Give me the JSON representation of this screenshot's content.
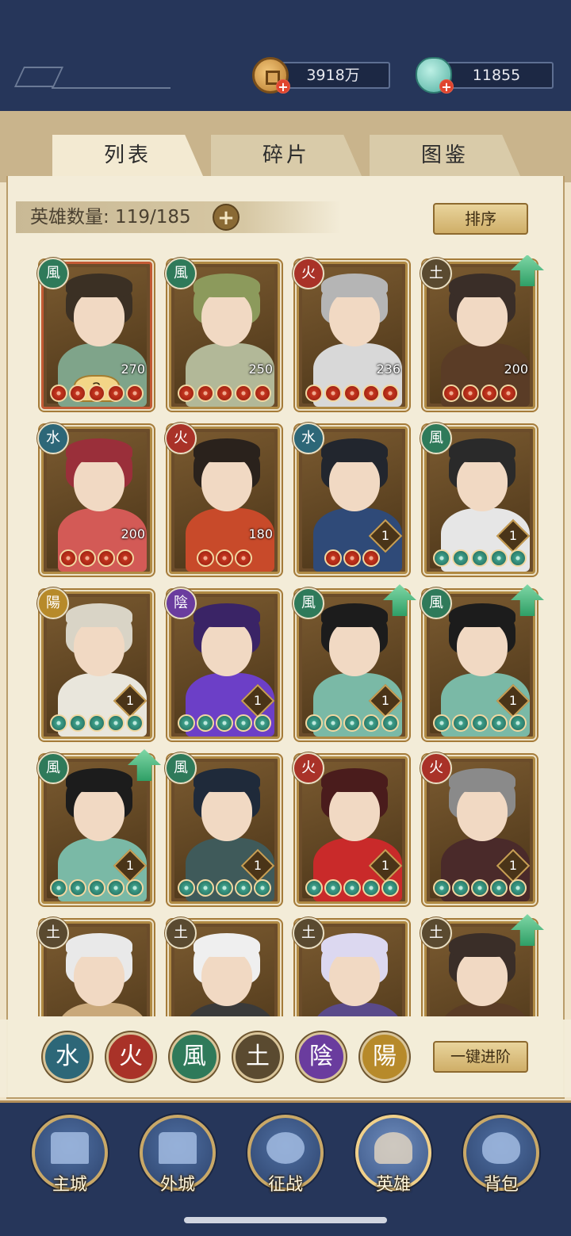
{
  "header": {
    "coins": "3918万",
    "jade": "11855"
  },
  "tabs": [
    {
      "label": "列表",
      "active": true
    },
    {
      "label": "碎片",
      "active": false
    },
    {
      "label": "图鉴",
      "active": false
    }
  ],
  "hero_count": "英雄数量: 119/185",
  "sort_label": "排序",
  "heroes": [
    {
      "element": "風",
      "level": "270",
      "stars": 5,
      "star_color": "red",
      "badge": "2",
      "upgrade": false
    },
    {
      "element": "風",
      "level": "250",
      "stars": 5,
      "star_color": "red",
      "upgrade": false
    },
    {
      "element": "火",
      "level": "236",
      "stars": 5,
      "star_color": "red",
      "upgrade": false
    },
    {
      "element": "土",
      "level": "200",
      "stars": 4,
      "star_color": "red",
      "upgrade": true
    },
    {
      "element": "水",
      "level": "200",
      "stars": 4,
      "star_color": "red",
      "upgrade": false
    },
    {
      "element": "火",
      "level": "180",
      "stars": 3,
      "star_color": "red",
      "upgrade": false
    },
    {
      "element": "水",
      "rank": "1",
      "stars": 3,
      "star_color": "red",
      "upgrade": false
    },
    {
      "element": "風",
      "rank": "1",
      "stars": 5,
      "star_color": "green",
      "upgrade": false
    },
    {
      "element": "陽",
      "rank": "1",
      "stars": 5,
      "star_color": "green",
      "upgrade": false
    },
    {
      "element": "陰",
      "rank": "1",
      "stars": 5,
      "star_color": "green",
      "upgrade": false
    },
    {
      "element": "風",
      "rank": "1",
      "stars": 5,
      "star_color": "green",
      "upgrade": true
    },
    {
      "element": "風",
      "rank": "1",
      "stars": 5,
      "star_color": "green",
      "upgrade": true
    },
    {
      "element": "風",
      "rank": "1",
      "stars": 5,
      "star_color": "green",
      "upgrade": true
    },
    {
      "element": "風",
      "rank": "1",
      "stars": 5,
      "star_color": "green",
      "upgrade": false
    },
    {
      "element": "火",
      "rank": "1",
      "stars": 5,
      "star_color": "green",
      "upgrade": false
    },
    {
      "element": "火",
      "rank": "1",
      "stars": 5,
      "star_color": "green",
      "upgrade": false
    },
    {
      "element": "土",
      "upgrade": false
    },
    {
      "element": "土",
      "upgrade": false
    },
    {
      "element": "土",
      "upgrade": false
    },
    {
      "element": "土",
      "upgrade": true
    }
  ],
  "filters": [
    {
      "label": "水",
      "name": "water"
    },
    {
      "label": "火",
      "name": "fire"
    },
    {
      "label": "風",
      "name": "wind"
    },
    {
      "label": "土",
      "name": "earth"
    },
    {
      "label": "陰",
      "name": "yin"
    },
    {
      "label": "陽",
      "name": "yang"
    }
  ],
  "advance_label": "一键进阶",
  "nav": [
    {
      "label": "主城",
      "active": false
    },
    {
      "label": "外城",
      "active": false
    },
    {
      "label": "征战",
      "active": false
    },
    {
      "label": "英雄",
      "active": true
    },
    {
      "label": "背包",
      "active": false
    }
  ],
  "colors": {
    "element_water": "#2d6778",
    "element_fire": "#a93228",
    "element_wind": "#2f7a5a",
    "element_earth": "#5a4a30",
    "element_yin": "#6a3c9e",
    "element_yang": "#b78a2a",
    "upgrade_arrow": "#2f9f66"
  }
}
